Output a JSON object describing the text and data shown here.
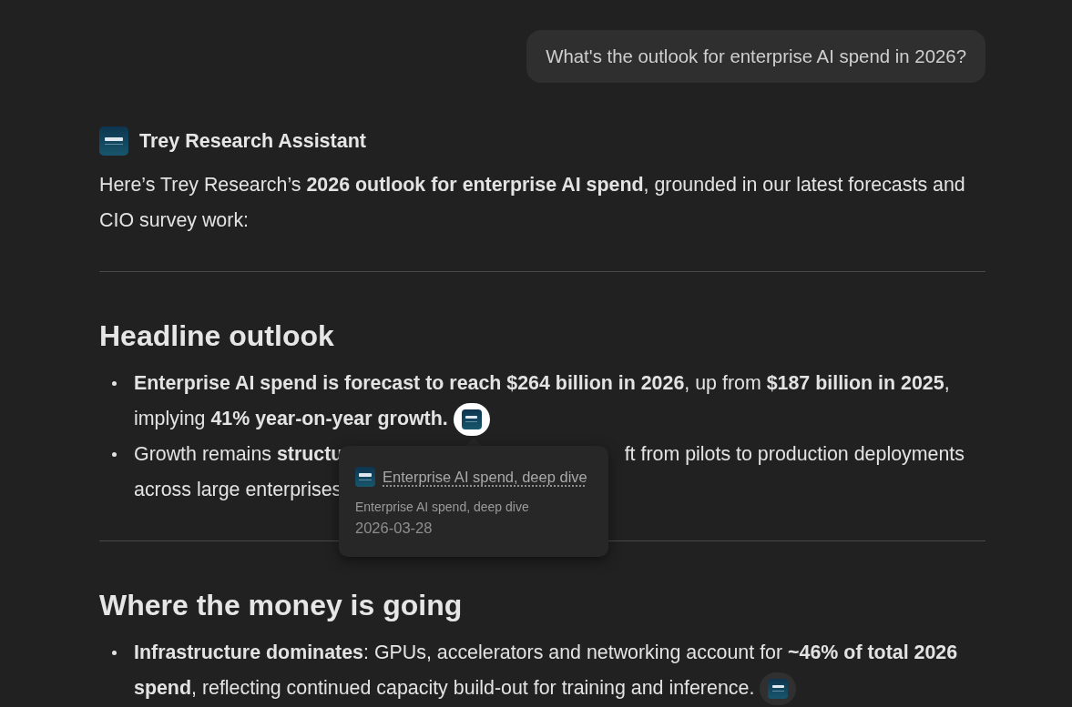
{
  "user_message": "What's the outlook for enterprise AI spend in 2026?",
  "assistant": {
    "name": "Trey Research Assistant"
  },
  "intro": "Here’s Trey Research’s **2026 outlook for enterprise AI spend**, grounded in our latest forecasts and CIO survey work:",
  "sections": [
    {
      "heading": "Headline outlook",
      "bullets": [
        {
          "kind": "cited",
          "lines": [
            "**Enterprise AI spend is forecast to reach $264 billion in 2026**, up from **$187 billion in 2025**,",
            "implying **41% year-on-year growth.**"
          ],
          "citation": {
            "active": true
          }
        },
        {
          "kind": "covered",
          "lines": [
            "Growth remains **structu**",
            "ft from pilots to production deployments",
            "across large enterprises"
          ]
        }
      ]
    },
    {
      "heading": "Where the money is going",
      "bullets": [
        {
          "kind": "cited",
          "lines": [
            "**Infrastructure dominates**: GPUs, accelerators and networking account for **~46% of total 2026**",
            "**spend**, reflecting continued capacity build-out for training and inference."
          ],
          "citation": {
            "active": false
          }
        }
      ]
    }
  ],
  "tooltip": {
    "title": "Enterprise AI spend, deep dive",
    "subtitle": "Enterprise AI spend, deep dive",
    "date": "2026-03-28"
  }
}
